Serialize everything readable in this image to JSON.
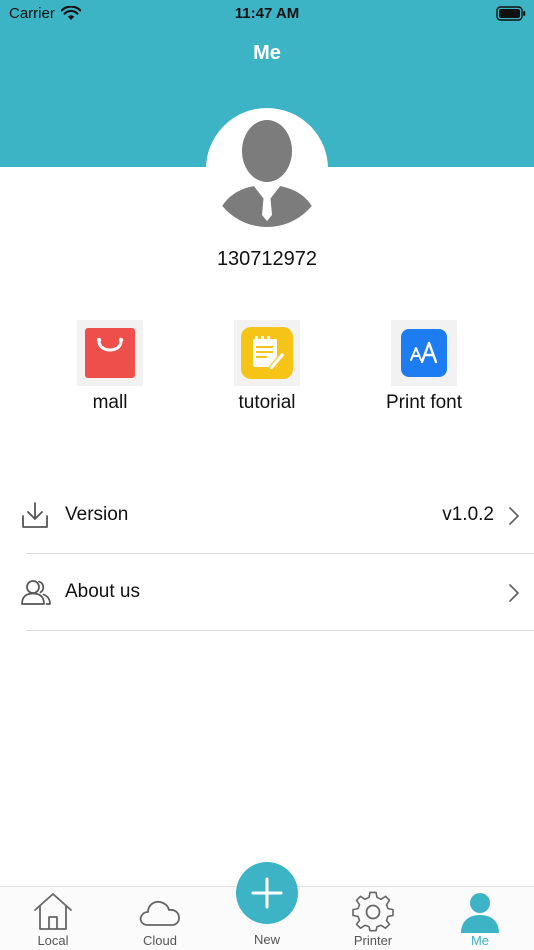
{
  "status_bar": {
    "carrier": "Carrier",
    "time": "11:47 AM"
  },
  "header": {
    "title": "Me"
  },
  "profile": {
    "username": "130712972"
  },
  "quick_actions": [
    {
      "label": "mall",
      "icon": "shopping-bag-icon",
      "color": "#ee4f4b"
    },
    {
      "label": "tutorial",
      "icon": "notepad-pen-icon",
      "color": "#f6c416"
    },
    {
      "label": "Print font",
      "icon": "font-size-icon",
      "color": "#1e7cf2"
    }
  ],
  "menu": [
    {
      "label": "Version",
      "value": "v1.0.2",
      "icon": "download-icon"
    },
    {
      "label": "About us",
      "value": "",
      "icon": "users-icon"
    }
  ],
  "tabbar": {
    "tabs": [
      {
        "label": "Local",
        "icon": "home-icon"
      },
      {
        "label": "Cloud",
        "icon": "cloud-icon"
      },
      {
        "label": "New",
        "icon": "plus-icon"
      },
      {
        "label": "Printer",
        "icon": "gear-icon"
      },
      {
        "label": "Me",
        "icon": "person-icon"
      }
    ],
    "active": "Me"
  },
  "colors": {
    "accent": "#3cb4c6",
    "divider": "#dedede"
  }
}
